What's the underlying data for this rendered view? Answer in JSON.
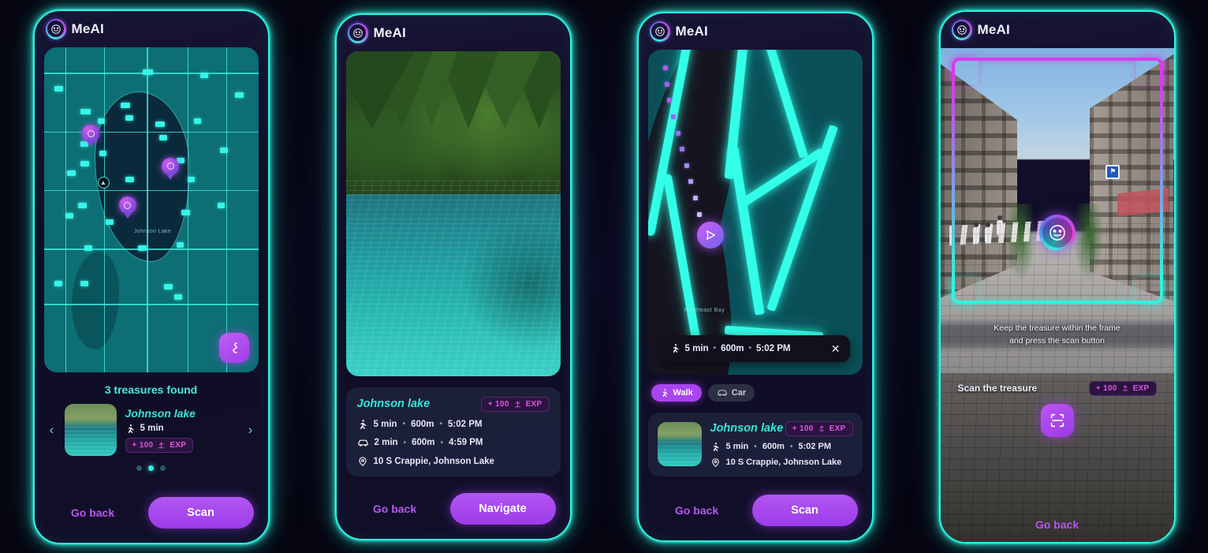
{
  "brand": {
    "name": "MeAI",
    "logo_icon": "meai-face-icon"
  },
  "colors": {
    "neon_cyan": "#2ff3e0",
    "teal_text": "#36e7d6",
    "purple": "#a845ef",
    "magenta": "#d63ceb",
    "exp_pink": "#e254e0",
    "card_bg": "#242a44"
  },
  "screens": [
    {
      "id": "discover",
      "map": {
        "label": "Johnson Lake",
        "pin_count": 3,
        "route_button_icon": "route-icon"
      },
      "found_title": "3 treasures found",
      "carousel": {
        "prev_icon": "chevron-left-icon",
        "next_icon": "chevron-right-icon",
        "item": {
          "name": "Johnson lake",
          "walk_icon": "walking-icon",
          "walk_time": "5 min",
          "exp": "+ 100",
          "exp_icon": "exp-icon",
          "exp_label": "EXP"
        },
        "dots": 3,
        "active_dot": 1
      },
      "footer": {
        "back_label": "Go back",
        "action_label": "Scan"
      }
    },
    {
      "id": "treasure-detail",
      "photo_alt": "johnson-lake-photo",
      "card": {
        "title": "Johnson lake",
        "exp": "+ 100",
        "exp_icon": "exp-icon",
        "exp_label": "EXP",
        "rows": [
          {
            "icon": "walking-icon",
            "time": "5 min",
            "distance": "600m",
            "arrival": "5:02 PM"
          },
          {
            "icon": "car-icon",
            "time": "2 min",
            "distance": "600m",
            "arrival": "4:59 PM"
          }
        ],
        "address_icon": "location-pin-icon",
        "address": "10 S Crappie, Johnson Lake"
      },
      "footer": {
        "back_label": "Go back",
        "action_label": "Navigate"
      }
    },
    {
      "id": "navigation",
      "map": {
        "area_label": "Northeast Bay",
        "nav_marker_icon": "navigation-arrow-icon"
      },
      "eta_bar": {
        "icon": "walking-icon",
        "time": "5 min",
        "distance": "600m",
        "arrival": "5:02 PM",
        "close_icon": "close-icon"
      },
      "modes": [
        {
          "label": "Walk",
          "icon": "walking-icon",
          "active": true
        },
        {
          "label": "Car",
          "icon": "car-icon",
          "active": false
        }
      ],
      "card": {
        "title": "Johnson lake",
        "exp": "+ 100",
        "exp_icon": "exp-icon",
        "exp_label": "EXP",
        "row": {
          "icon": "walking-icon",
          "time": "5 min",
          "distance": "600m",
          "arrival": "5:02 PM"
        },
        "address_icon": "location-pin-icon",
        "address": "10 S Crappie, Johnson Lake"
      },
      "footer": {
        "back_label": "Go back",
        "action_label": "Scan"
      }
    },
    {
      "id": "ar-scan",
      "hint_line1": "Keep the treasure within the frame",
      "hint_line2": "and press the scan button",
      "scan_label": "Scan the treasure",
      "exp": "+ 100",
      "exp_icon": "exp-icon",
      "exp_label": "EXP",
      "scan_button_icon": "scan-frame-icon",
      "target_badge_icon": "meai-face-icon",
      "footer": {
        "back_label": "Go back"
      }
    }
  ],
  "separator": "•"
}
